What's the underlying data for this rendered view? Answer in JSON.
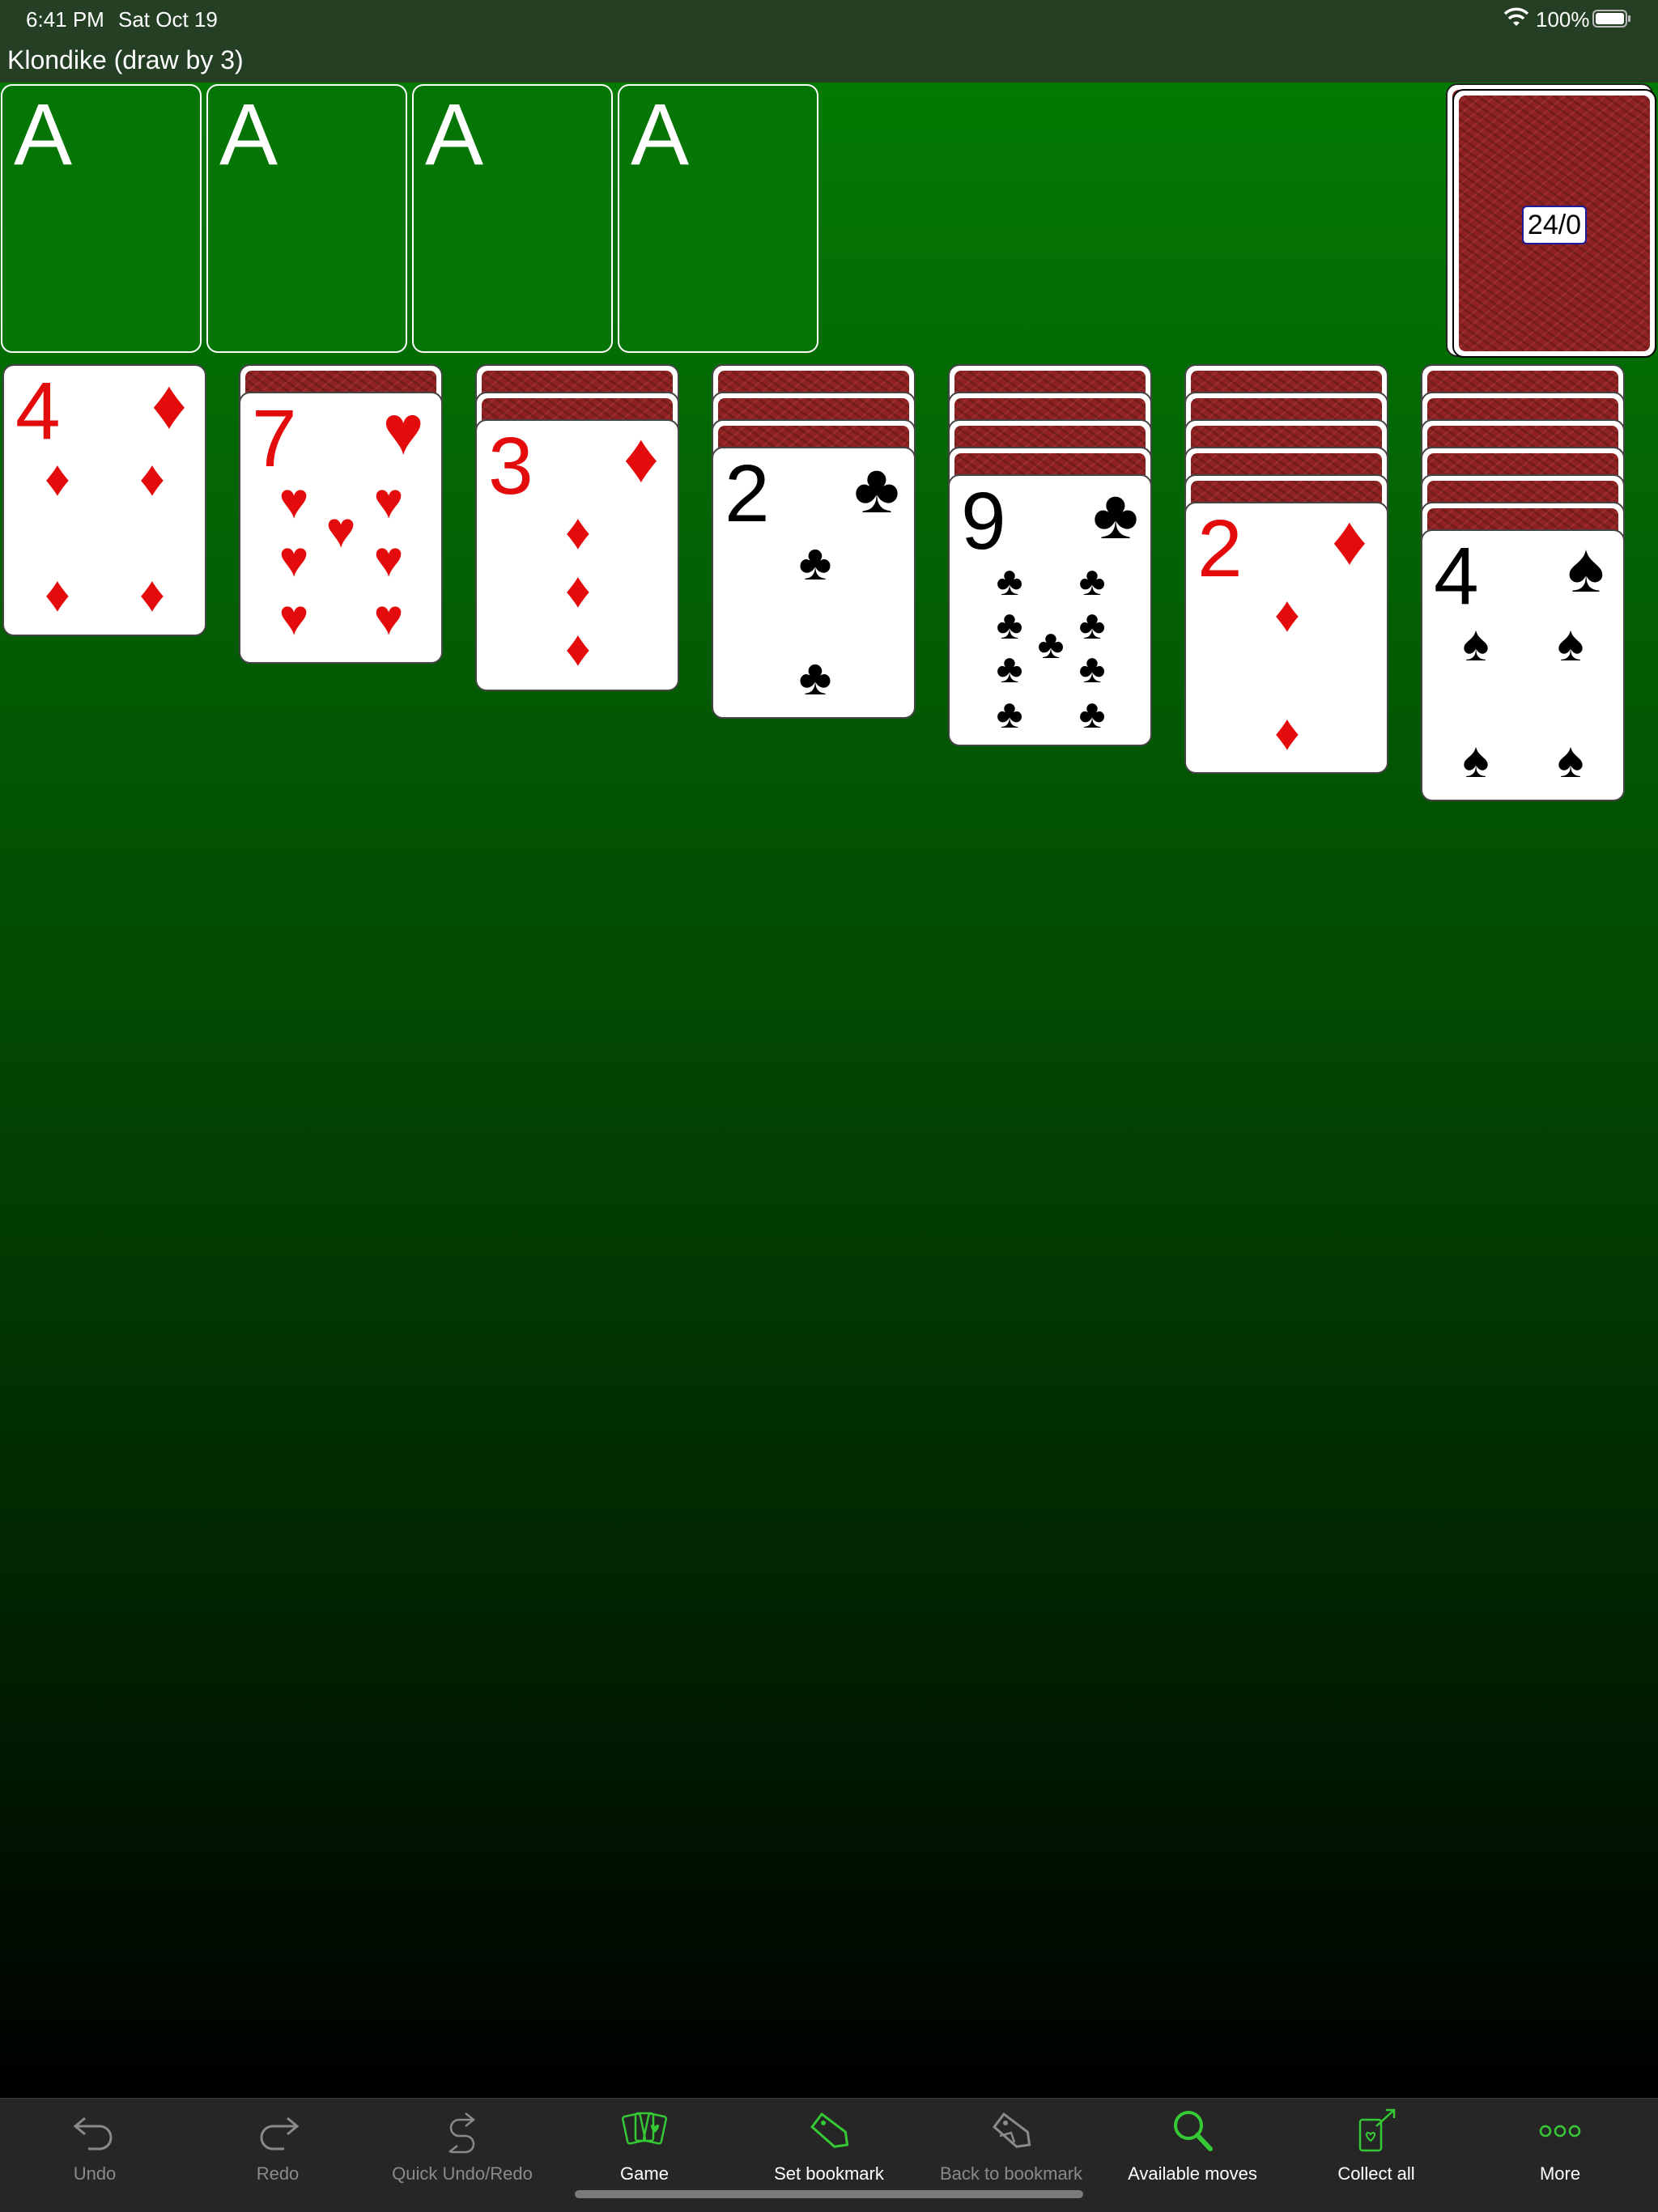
{
  "status": {
    "time": "6:41 PM",
    "date": "Sat Oct 19",
    "battery": "100%"
  },
  "title": "Klondike (draw by 3)",
  "foundations": [
    "A",
    "A",
    "A",
    "A"
  ],
  "stock": {
    "count": "24/0"
  },
  "tableau": [
    {
      "hidden": 0,
      "card": {
        "rank": "4",
        "suit": "♦",
        "color": "red"
      }
    },
    {
      "hidden": 1,
      "card": {
        "rank": "7",
        "suit": "♥",
        "color": "red"
      }
    },
    {
      "hidden": 2,
      "card": {
        "rank": "3",
        "suit": "♦",
        "color": "red"
      }
    },
    {
      "hidden": 3,
      "card": {
        "rank": "2",
        "suit": "♣",
        "color": "black"
      }
    },
    {
      "hidden": 4,
      "card": {
        "rank": "9",
        "suit": "♣",
        "color": "black"
      }
    },
    {
      "hidden": 5,
      "card": {
        "rank": "2",
        "suit": "♦",
        "color": "red"
      }
    },
    {
      "hidden": 6,
      "card": {
        "rank": "4",
        "suit": "♠",
        "color": "black"
      }
    }
  ],
  "toolbar": [
    {
      "label": "Undo",
      "icon": "undo-icon",
      "enabled": false
    },
    {
      "label": "Redo",
      "icon": "redo-icon",
      "enabled": false
    },
    {
      "label": "Quick Undo/Redo",
      "icon": "quick-undo-redo-icon",
      "enabled": false
    },
    {
      "label": "Game",
      "icon": "game-cards-icon",
      "enabled": true
    },
    {
      "label": "Set bookmark",
      "icon": "bookmark-icon",
      "enabled": true
    },
    {
      "label": "Back to bookmark",
      "icon": "back-to-bookmark-icon",
      "enabled": false
    },
    {
      "label": "Available moves",
      "icon": "magnifier-icon",
      "enabled": true
    },
    {
      "label": "Collect all",
      "icon": "collect-all-icon",
      "enabled": true
    },
    {
      "label": "More",
      "icon": "more-icon",
      "enabled": true
    }
  ],
  "colors": {
    "felt_top": "#037a03",
    "felt_bottom": "#000000",
    "accent": "#35c935",
    "red_suit": "#e30b0b"
  }
}
